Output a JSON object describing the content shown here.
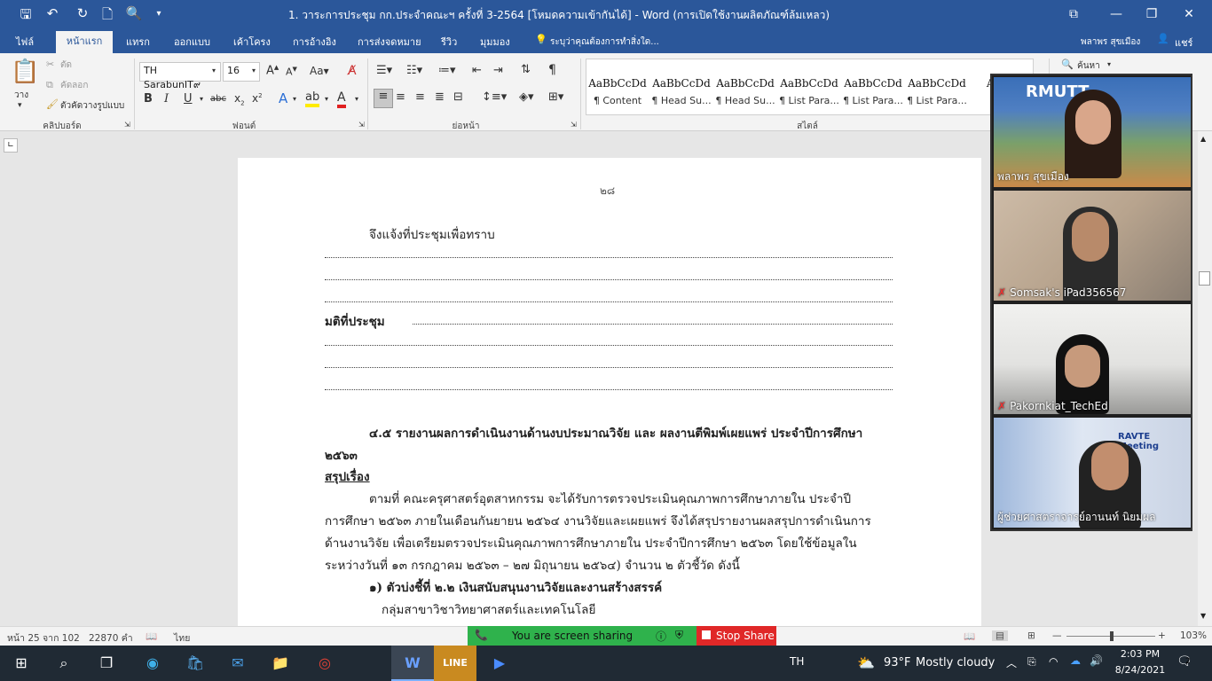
{
  "titlebar": {
    "title": "1. วาระการประชุม กก.ประจำคณะฯ ครั้งที่ 3-2564 [โหมดความเข้ากันได้] - Word (การเปิดใช้งานผลิตภัณฑ์ล้มเหลว)",
    "user": "พลาพร สุขเมือง",
    "share": "แชร์"
  },
  "tabs": [
    "ไฟล์",
    "หน้าแรก",
    "แทรก",
    "ออกแบบ",
    "เค้าโครง",
    "การอ้างอิง",
    "การส่งจดหมาย",
    "รีวิว",
    "มุมมอง"
  ],
  "tell_me": "ระบุว่าคุณต้องการทำสิ่งใด...",
  "ribbon": {
    "clipboard": {
      "paste": "วาง",
      "cut": "ตัด",
      "copy": "คัดลอก",
      "format_painter": "ตัวคัดวางรูปแบบ",
      "label": "คลิปบอร์ด"
    },
    "font": {
      "name": "TH SarabunIT๙",
      "size": "16",
      "label": "ฟอนต์"
    },
    "paragraph": {
      "label": "ย่อหน้า"
    },
    "styles": {
      "label": "สไตล์",
      "items": [
        {
          "sample": "AaBbCcDd",
          "name": "¶ Content"
        },
        {
          "sample": "AaBbCcDd",
          "name": "¶ Head Su..."
        },
        {
          "sample": "AaBbCcDd",
          "name": "¶ Head Su..."
        },
        {
          "sample": "AaBbCcDd",
          "name": "¶ List Para..."
        },
        {
          "sample": "AaBbCcDd",
          "name": "¶ List Para..."
        },
        {
          "sample": "AaBbCcDd",
          "name": "¶ List Para..."
        },
        {
          "sample": "AaBb",
          "name": "¶ ไ"
        }
      ]
    },
    "find": "ค้นหา"
  },
  "document": {
    "page_number": "๒๘",
    "line1": "จึงแจ้งที่ประชุมเพื่อทราบ",
    "resolution_label": "มติที่ประชุม",
    "heading_a": "๔.๕ รายงานผลการดำเนินงานด้านงบประมาณวิจัย และ ผลงานตีพิมพ์เผยแพร่ ประจำปีการศึกษา",
    "heading_b": "๒๕๖๓",
    "summary_label": "สรุปเรื่อง",
    "para": [
      "ตามที่ คณะครุศาสตร์อุตสาหกรรม จะได้รับการตรวจประเมินคุณภาพการศึกษาภายใน ประจำปี",
      "การศึกษา ๒๕๖๓ ภายในเดือนกันยายน ๒๕๖๔ งานวิจัยและเผยแพร่ จึงได้สรุปรายงานผลสรุปการดำเนินการ",
      "ด้านงานวิจัย เพื่อเตรียมตรวจประเมินคุณภาพการศึกษาภายใน ประจำปีการศึกษา ๒๕๖๓ โดยใช้ข้อมูลใน",
      "ระหว่างวันที่ ๑๓ กรกฎาคม ๒๕๖๓ – ๒๗ มิถุนายน ๒๕๖๔) จำนวน ๒  ตัวชี้วัด ดังนี้"
    ],
    "indicator": "๑) ตัวบ่งชี้ที่ ๒.๒ เงินสนับสนุนงานวิจัยและงานสร้างสรรค์",
    "group": "กลุ่มสาขาวิชาวิทยาศาสตร์และเทคโนโลยี"
  },
  "zoom": {
    "participants": [
      "พลาพร สุขเมือง",
      "Somsak's iPad356567",
      "Pakornkiat_TechEd",
      "ผู้ช่วยศาสตราจารย์อานนท์ นิยมผล"
    ],
    "share_status": "You are screen sharing",
    "stop_share": "Stop Share",
    "tile1_logo": "RMUTT",
    "tile4_banner": "RAVTE Meeting"
  },
  "statusbar": {
    "page": "หน้า 25 จาก 102",
    "words": "22870 คำ",
    "language": "ไทย",
    "zoom_level": "103%"
  },
  "taskbar": {
    "lang": "TH",
    "temperature": "93°F",
    "weather": "Mostly cloudy",
    "time": "2:03 PM",
    "date": "8/24/2021",
    "notifications": "2"
  },
  "colors": {
    "word_blue": "#2b579a",
    "share_green": "#2fb24c",
    "stop_red": "#e02828",
    "taskbar": "#202a34"
  }
}
